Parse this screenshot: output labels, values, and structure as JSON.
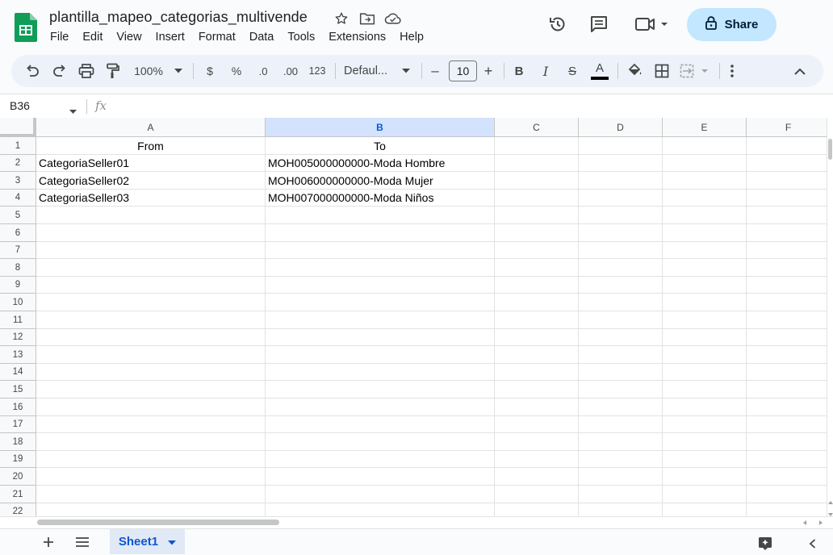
{
  "document": {
    "title": "plantilla_mapeo_categorias_multivende"
  },
  "menu": [
    "File",
    "Edit",
    "View",
    "Insert",
    "Format",
    "Data",
    "Tools",
    "Extensions",
    "Help"
  ],
  "share": {
    "label": "Share"
  },
  "toolbar": {
    "zoom": "100%",
    "currency": "$",
    "percent": "%",
    "decrease_decimal": ".0",
    "increase_decimal": ".00",
    "number_format": "123",
    "font": "Defaul...",
    "font_size": "10",
    "minus": "–",
    "plus": "+",
    "bold": "B",
    "italic": "I",
    "strike": "S",
    "text_color": "A"
  },
  "formula_bar": {
    "name_box": "B36",
    "fx": "fx",
    "value": ""
  },
  "grid": {
    "columns": [
      "A",
      "B",
      "C",
      "D",
      "E",
      "F"
    ],
    "selected_column": "B",
    "row_numbers": [
      "1",
      "2",
      "3",
      "4",
      "5",
      "6",
      "7",
      "8",
      "9",
      "10",
      "11",
      "12",
      "13",
      "14",
      "15",
      "16",
      "17",
      "18",
      "19",
      "20",
      "21",
      "22"
    ],
    "cells": {
      "A1": "From",
      "B1": "To",
      "A2": "CategoriaSeller01",
      "B2": "MOH005000000000-Moda Hombre",
      "A3": "CategoriaSeller02",
      "B3": "MOH006000000000-Moda Mujer",
      "A4": "CategoriaSeller03",
      "B4": "MOH007000000000-Moda Niños"
    }
  },
  "sheets": {
    "active": "Sheet1"
  },
  "colors": {
    "accent": "#0b57d0",
    "share_bg": "#c2e7ff",
    "selected_header": "#d3e3fd",
    "sheets_green": "#0f9d58"
  }
}
